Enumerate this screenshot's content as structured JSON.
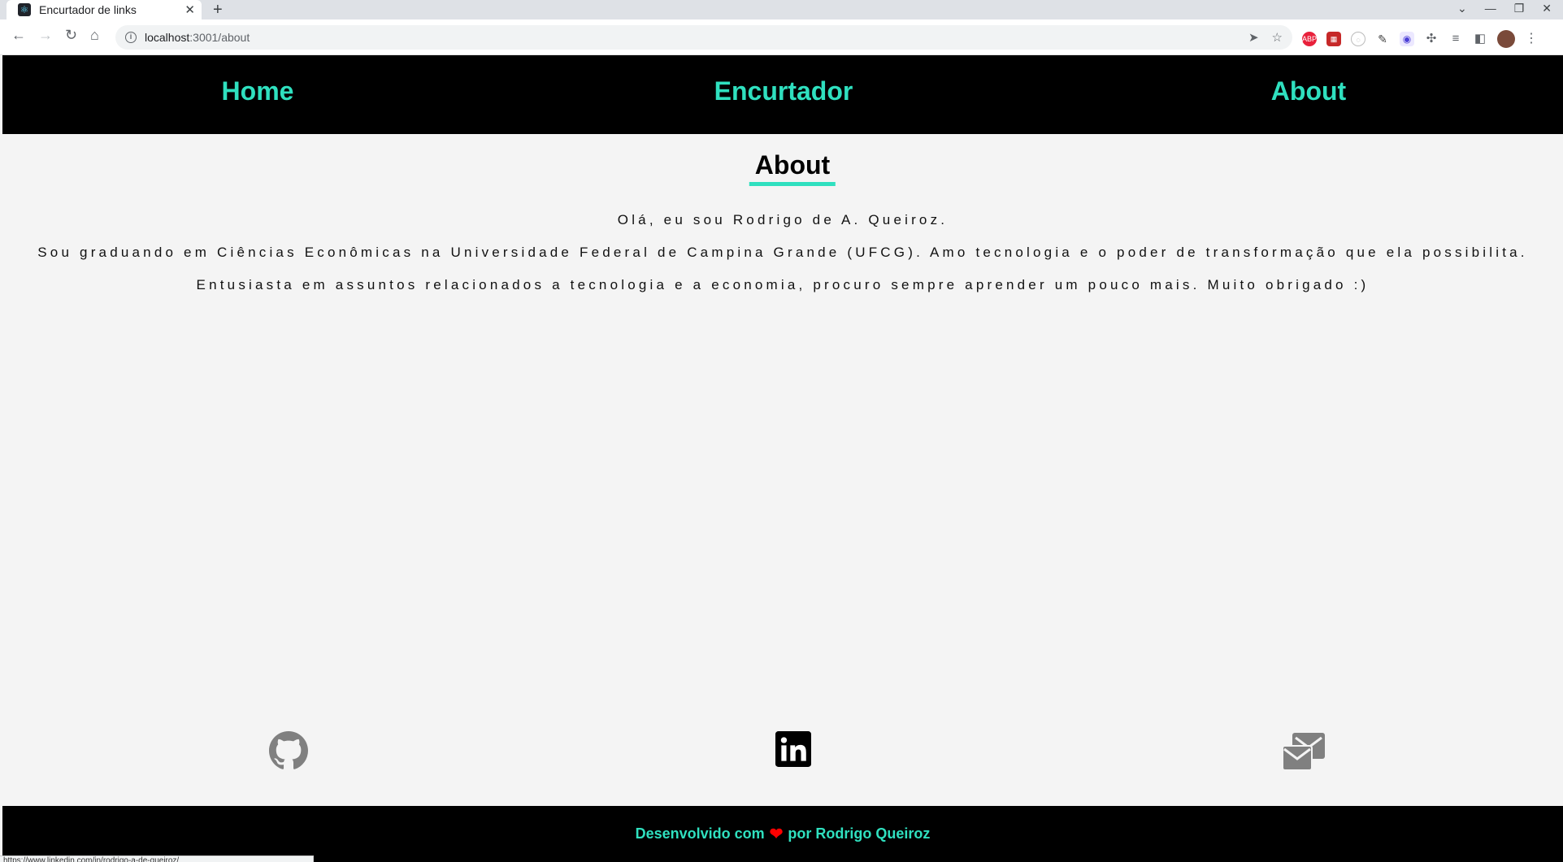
{
  "browser": {
    "tab_title": "Encurtador de links",
    "url_host": "localhost",
    "url_path": ":3001/about",
    "ext_abp": "ABP",
    "status_url": "https://www.linkedin.com/in/rodrigo-a-de-queiroz/"
  },
  "nav": {
    "home": "Home",
    "shortener": "Encurtador",
    "about": "About"
  },
  "about": {
    "title": "About",
    "paragraphs": [
      "Olá, eu sou Rodrigo de A. Queiroz.",
      "Sou graduando em Ciências Econômicas na Universidade Federal de Campina Grande (UFCG). Amo tecnologia e o poder de transformação que ela possibilita.",
      "Entusiasta em assuntos relacionados a tecnologia e a economia, procuro sempre aprender um pouco mais. Muito obrigado :)"
    ]
  },
  "social": {
    "github": "github-icon",
    "linkedin": "linkedin-icon",
    "email": "email-icon"
  },
  "footer": {
    "prefix": "Desenvolvido com",
    "heart": "❤",
    "suffix": "por Rodrigo Queiroz"
  },
  "colors": {
    "accent": "#2fe0bf",
    "nav_bg": "#000000",
    "page_bg": "#f4f4f4",
    "heart": "#ff0000"
  }
}
